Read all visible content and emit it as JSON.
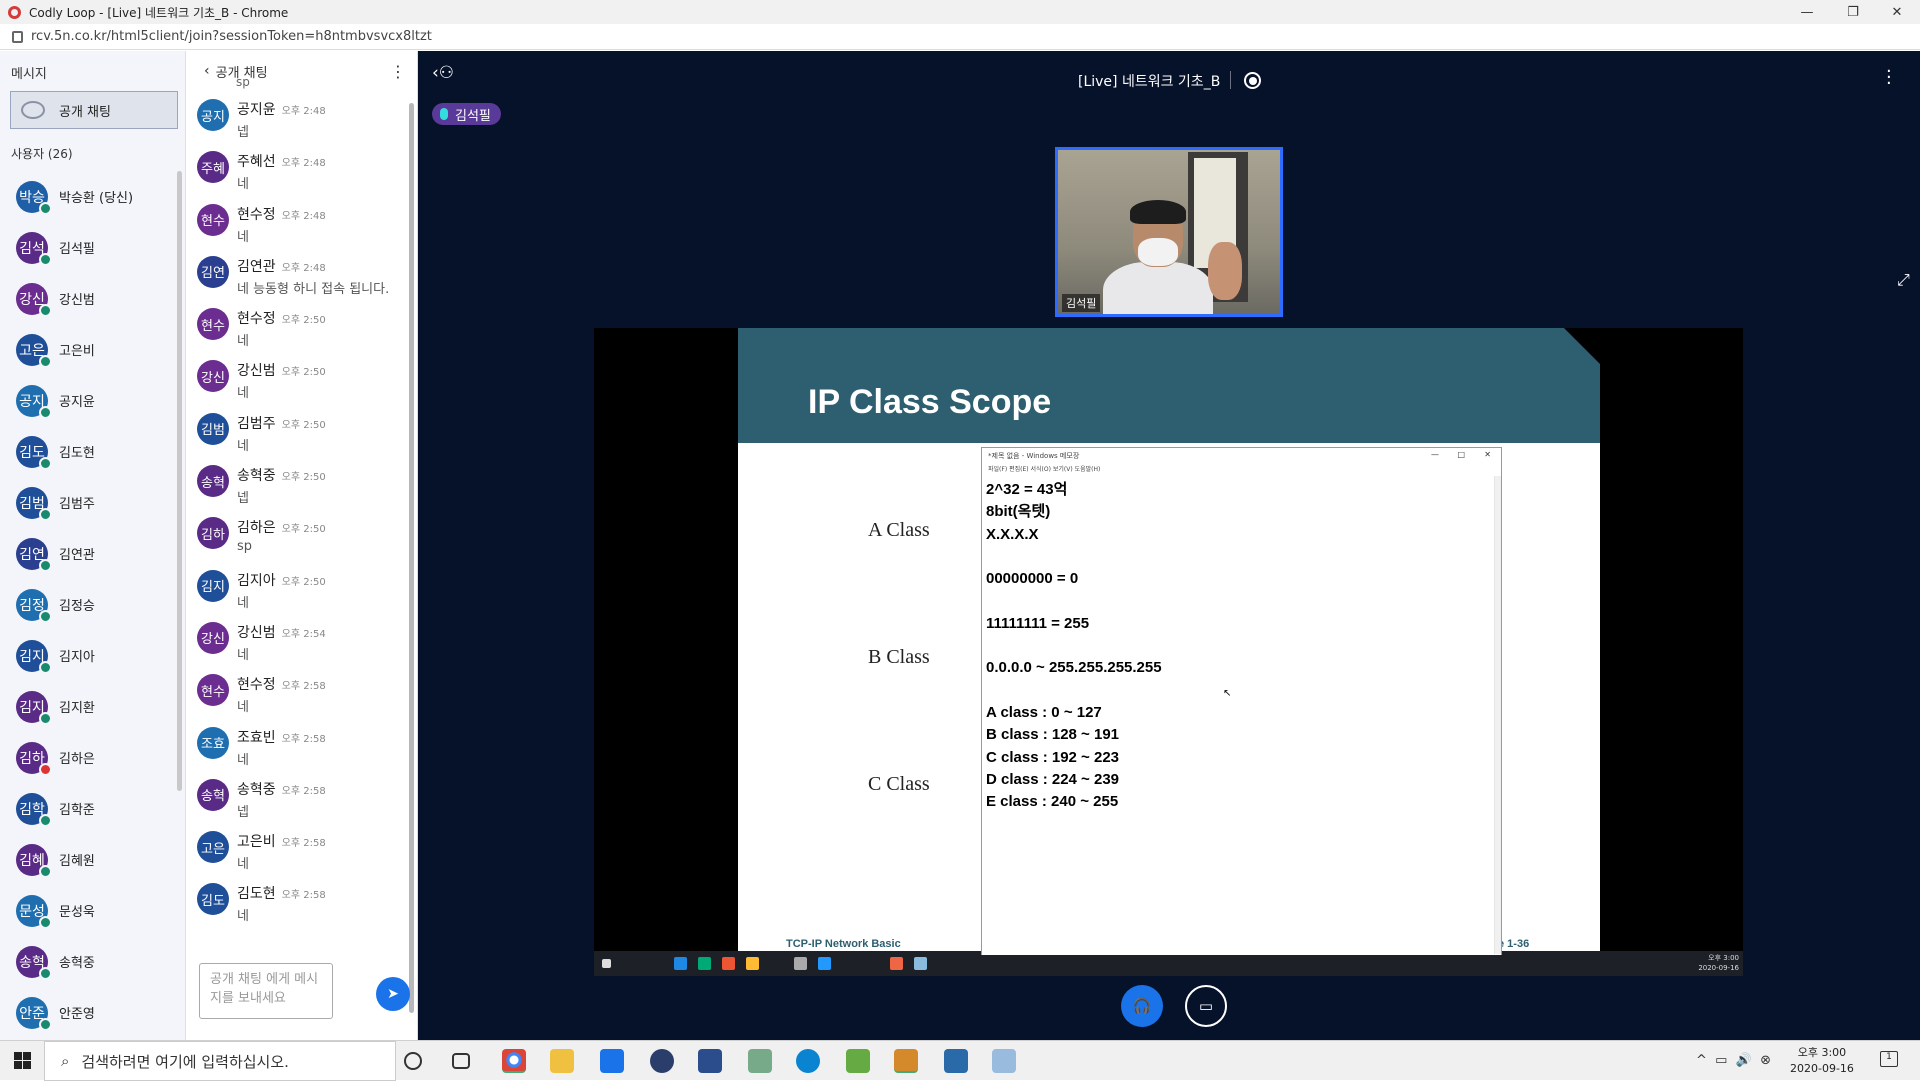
{
  "window": {
    "title": "Codly Loop - [Live] 네트워크 기초_B - Chrome",
    "minimize": "—",
    "maximize": "❐",
    "close": "✕"
  },
  "address": {
    "url": "rcv.5n.co.kr/html5client/join?sessionToken=h8ntmbvsvcx8ltzt"
  },
  "sidebar": {
    "messages_label": "메시지",
    "public_chat_label": "공개 채팅",
    "users_label": "사용자 (26)",
    "users": [
      {
        "avatar": "박승",
        "name": "박승환 (당신)",
        "color": "#1f5fa8",
        "status": "green"
      },
      {
        "avatar": "김석",
        "name": "김석필",
        "color": "#5a2b86",
        "status": "green"
      },
      {
        "avatar": "강신",
        "name": "강신범",
        "color": "#6b2d8f",
        "status": "green"
      },
      {
        "avatar": "고은",
        "name": "고은비",
        "color": "#1f4f99",
        "status": "green"
      },
      {
        "avatar": "공지",
        "name": "공지윤",
        "color": "#1f6fb0",
        "status": "green"
      },
      {
        "avatar": "김도",
        "name": "김도현",
        "color": "#1f4f99",
        "status": "green"
      },
      {
        "avatar": "김범",
        "name": "김범주",
        "color": "#1f4f99",
        "status": "green"
      },
      {
        "avatar": "김연",
        "name": "김연관",
        "color": "#2a3f8f",
        "status": "green"
      },
      {
        "avatar": "김정",
        "name": "김정승",
        "color": "#1f6fb0",
        "status": "green"
      },
      {
        "avatar": "김지",
        "name": "김지아",
        "color": "#1f4f99",
        "status": "green"
      },
      {
        "avatar": "김지",
        "name": "김지환",
        "color": "#5a2b86",
        "status": "green"
      },
      {
        "avatar": "김하",
        "name": "김하은",
        "color": "#5a2b86",
        "status": "red"
      },
      {
        "avatar": "김학",
        "name": "김학준",
        "color": "#1f4f99",
        "status": "green"
      },
      {
        "avatar": "김혜",
        "name": "김혜원",
        "color": "#5a2b86",
        "status": "green"
      },
      {
        "avatar": "문성",
        "name": "문성욱",
        "color": "#1f6fb0",
        "status": "green"
      },
      {
        "avatar": "송혁",
        "name": "송혁중",
        "color": "#5a2b86",
        "status": "green"
      },
      {
        "avatar": "안준",
        "name": "안준영",
        "color": "#1f6fb0",
        "status": "green"
      }
    ]
  },
  "chat": {
    "header": "공개 채팅",
    "partial_top": "sp",
    "messages": [
      {
        "avatar": "공지",
        "who": "공지윤",
        "time": "오후 2:48",
        "text": "넵",
        "color": "#1f6fb0"
      },
      {
        "avatar": "주혜",
        "who": "주혜선",
        "time": "오후 2:48",
        "text": "네",
        "color": "#5a2b86"
      },
      {
        "avatar": "현수",
        "who": "현수정",
        "time": "오후 2:48",
        "text": "네",
        "color": "#6b2d8f"
      },
      {
        "avatar": "김연",
        "who": "김연관",
        "time": "오후 2:48",
        "text": "네 능동형 하니 접속 됩니다.",
        "color": "#2a3f8f"
      },
      {
        "avatar": "현수",
        "who": "현수정",
        "time": "오후 2:50",
        "text": "네",
        "color": "#6b2d8f"
      },
      {
        "avatar": "강신",
        "who": "강신범",
        "time": "오후 2:50",
        "text": "네",
        "color": "#6b2d8f"
      },
      {
        "avatar": "김범",
        "who": "김범주",
        "time": "오후 2:50",
        "text": "네",
        "color": "#1f4f99"
      },
      {
        "avatar": "송혁",
        "who": "송혁중",
        "time": "오후 2:50",
        "text": "넵",
        "color": "#5a2b86"
      },
      {
        "avatar": "김하",
        "who": "김하은",
        "time": "오후 2:50",
        "text": "sp",
        "color": "#5a2b86"
      },
      {
        "avatar": "김지",
        "who": "김지아",
        "time": "오후 2:50",
        "text": "네",
        "color": "#1f4f99"
      },
      {
        "avatar": "강신",
        "who": "강신범",
        "time": "오후 2:54",
        "text": "네",
        "color": "#6b2d8f"
      },
      {
        "avatar": "현수",
        "who": "현수정",
        "time": "오후 2:58",
        "text": "네",
        "color": "#6b2d8f"
      },
      {
        "avatar": "조효",
        "who": "조효빈",
        "time": "오후 2:58",
        "text": "네",
        "color": "#1f6fb0"
      },
      {
        "avatar": "송혁",
        "who": "송혁중",
        "time": "오후 2:58",
        "text": "넵",
        "color": "#5a2b86"
      },
      {
        "avatar": "고은",
        "who": "고은비",
        "time": "오후 2:58",
        "text": "네",
        "color": "#1f4f99"
      },
      {
        "avatar": "김도",
        "who": "김도현",
        "time": "오후 2:58",
        "text": "네",
        "color": "#1f4f99"
      }
    ],
    "input_placeholder": "공개 채팅 에게 메시지를 보내세요"
  },
  "meeting": {
    "title": "[Live] 네트워크 기초_B",
    "active_speaker": "김석필",
    "webcam_label": "김석필"
  },
  "slide": {
    "title": "IP Class Scope",
    "classes": [
      "A Class",
      "B Class",
      "C Class"
    ],
    "footer": "TCP-IP Network Basic",
    "page": "e 1-36"
  },
  "notepad": {
    "title": "*제목 없음 - Windows 메모장",
    "menu": "파일(F)   편집(E)   서식(O)   보기(V)   도움말(H)",
    "text": "2^32 = 43억\n8bit(옥텟)\nX.X.X.X\n\n00000000 = 0\n\n11111111 = 255\n\n0.0.0.0 ~ 255.255.255.255\n\nA class : 0 ~ 127\nB class : 128 ~ 191\nC class : 192 ~ 223\nD class : 224 ~ 239\nE class : 240 ~ 255"
  },
  "shared_taskbar": {
    "time": "오후 3:00",
    "date": "2020-09-16"
  },
  "taskbar": {
    "search_placeholder": "검색하려면 여기에 입력하십시오.",
    "time": "오후 3:00",
    "date": "2020-09-16",
    "notifications": "1"
  }
}
